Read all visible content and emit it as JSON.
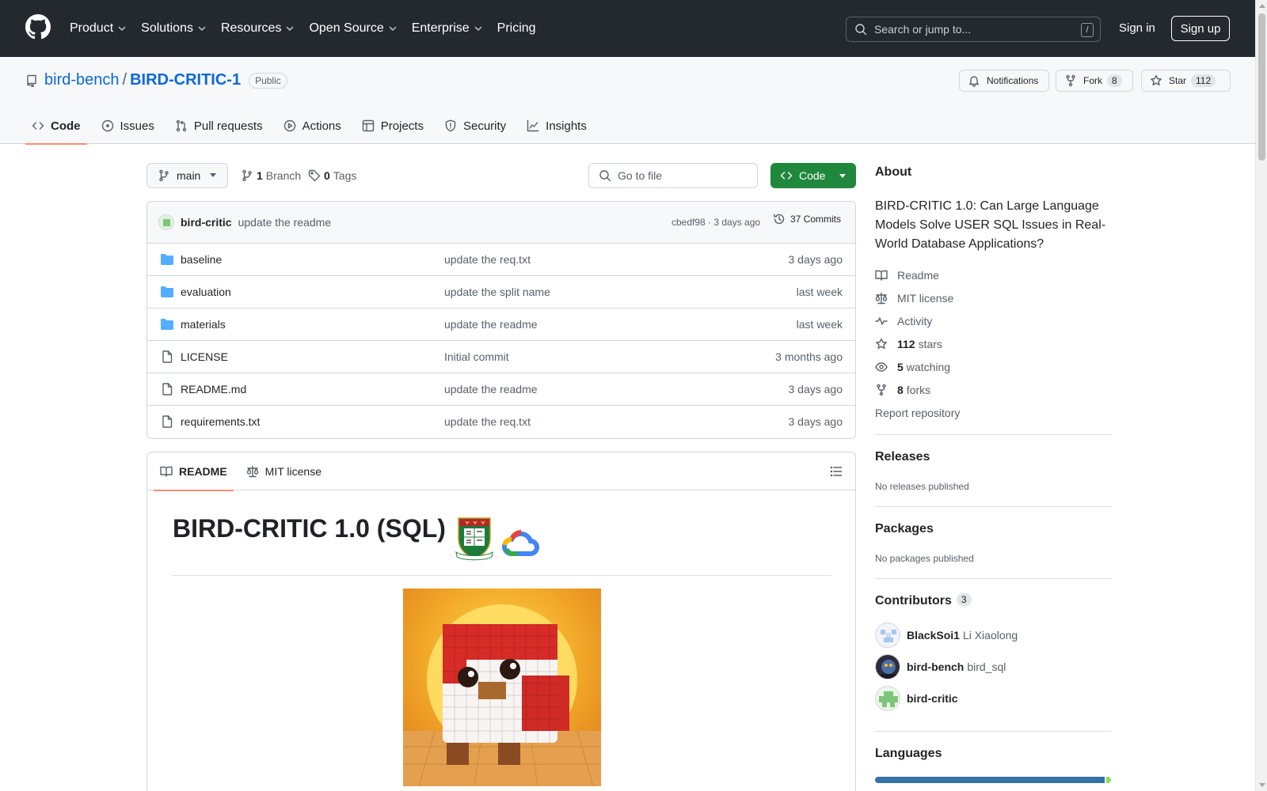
{
  "header": {
    "logo_icon": "github-mark-icon",
    "nav": [
      {
        "label": "Product",
        "has_menu": true
      },
      {
        "label": "Solutions",
        "has_menu": true
      },
      {
        "label": "Resources",
        "has_menu": true
      },
      {
        "label": "Open Source",
        "has_menu": true
      },
      {
        "label": "Enterprise",
        "has_menu": true
      },
      {
        "label": "Pricing",
        "has_menu": false
      }
    ],
    "search_placeholder": "Search or jump to...",
    "search_shortcut": "/",
    "sign_in": "Sign in",
    "sign_up": "Sign up"
  },
  "repo": {
    "owner": "bird-bench",
    "separator": "/",
    "name": "BIRD-CRITIC-1",
    "visibility": "Public",
    "notifications_label": "Notifications",
    "fork_label": "Fork",
    "fork_count": "8",
    "star_label": "Star",
    "star_count": "112",
    "tabs": [
      {
        "label": "Code",
        "icon": "code-icon",
        "active": true
      },
      {
        "label": "Issues",
        "icon": "issue-icon",
        "active": false
      },
      {
        "label": "Pull requests",
        "icon": "pull-request-icon",
        "active": false
      },
      {
        "label": "Actions",
        "icon": "play-icon",
        "active": false
      },
      {
        "label": "Projects",
        "icon": "table-icon",
        "active": false
      },
      {
        "label": "Security",
        "icon": "shield-icon",
        "active": false
      },
      {
        "label": "Insights",
        "icon": "graph-icon",
        "active": false
      }
    ]
  },
  "toolbar": {
    "branch": "main",
    "branch_count": "1",
    "branch_label": "Branch",
    "tag_count": "0",
    "tag_label": "Tags",
    "goto_placeholder": "Go to file",
    "code_button": "Code"
  },
  "commit": {
    "author": "bird-critic",
    "message": "update the readme",
    "hash_and_time": "cbedf98 · 3 days ago",
    "commits_label": "37 Commits"
  },
  "files": [
    {
      "name": "baseline",
      "type": "dir",
      "message": "update the req.txt",
      "date": "3 days ago"
    },
    {
      "name": "evaluation",
      "type": "dir",
      "message": "update the split name",
      "date": "last week"
    },
    {
      "name": "materials",
      "type": "dir",
      "message": "update the readme",
      "date": "last week"
    },
    {
      "name": "LICENSE",
      "type": "file",
      "message": "Initial commit",
      "date": "3 months ago"
    },
    {
      "name": "README.md",
      "type": "file",
      "message": "update the readme",
      "date": "3 days ago"
    },
    {
      "name": "requirements.txt",
      "type": "file",
      "message": "update the req.txt",
      "date": "3 days ago"
    }
  ],
  "readme": {
    "tab_readme": "README",
    "tab_license": "MIT license",
    "title": "BIRD-CRITIC 1.0 (SQL)"
  },
  "sidebar": {
    "about_heading": "About",
    "about_desc": "BIRD-CRITIC 1.0: Can Large Language Models Solve USER SQL Issues in Real-World Database Applications?",
    "readme_link": "Readme",
    "license_link": "MIT license",
    "activity_link": "Activity",
    "stars_count": "112",
    "stars_label": "stars",
    "watching_count": "5",
    "watching_label": "watching",
    "forks_count": "8",
    "forks_label": "forks",
    "report_link": "Report repository",
    "releases_heading": "Releases",
    "releases_none": "No releases published",
    "packages_heading": "Packages",
    "packages_none": "No packages published",
    "contributors_heading": "Contributors",
    "contributors_count": "3",
    "contributors": [
      {
        "login": "BlackSoi1",
        "full": "Li Xiaolong"
      },
      {
        "login": "bird-bench",
        "full": "bird_sql"
      },
      {
        "login": "bird-critic",
        "full": ""
      }
    ],
    "languages_heading": "Languages",
    "lang_bar": [
      {
        "share": 0.98,
        "color": "#3572A5"
      },
      {
        "share": 0.02,
        "color": "#89e051"
      }
    ]
  },
  "colors": {
    "header_bg": "#24292f",
    "link": "#0969da",
    "code_button": "#1f883d",
    "active_tab": "#fd8c73",
    "folder": "#54aeff"
  }
}
